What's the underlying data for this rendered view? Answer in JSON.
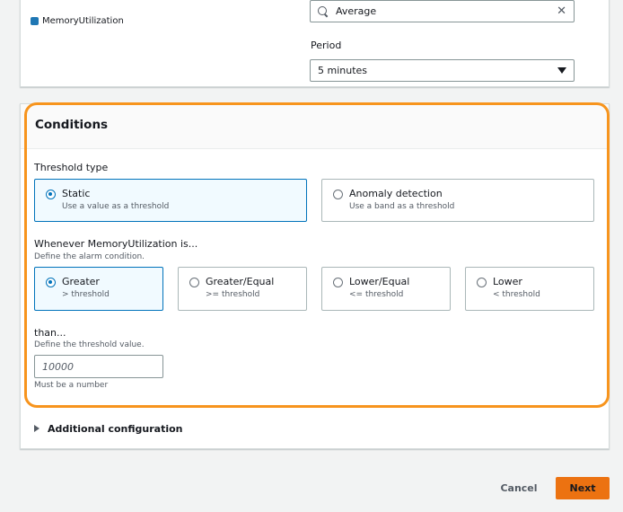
{
  "metric": {
    "legend_label": "MemoryUtilization",
    "legend_color": "#1f77b4",
    "statistic_value": "Average",
    "period_label": "Period",
    "period_value": "5 minutes"
  },
  "conditions": {
    "title": "Conditions",
    "threshold_type": {
      "label": "Threshold type",
      "options": [
        {
          "title": "Static",
          "desc": "Use a value as a threshold",
          "selected": true
        },
        {
          "title": "Anomaly detection",
          "desc": "Use a band as a threshold",
          "selected": false
        }
      ]
    },
    "whenever": {
      "label": "Whenever MemoryUtilization is...",
      "desc": "Define the alarm condition.",
      "options": [
        {
          "title": "Greater",
          "desc": "> threshold",
          "selected": true
        },
        {
          "title": "Greater/Equal",
          "desc": ">= threshold",
          "selected": false
        },
        {
          "title": "Lower/Equal",
          "desc": "<= threshold",
          "selected": false
        },
        {
          "title": "Lower",
          "desc": "< threshold",
          "selected": false
        }
      ]
    },
    "than": {
      "label": "than...",
      "desc": "Define the threshold value.",
      "placeholder": "10000",
      "constraint": "Must be a number"
    }
  },
  "additional": {
    "label": "Additional configuration"
  },
  "footer": {
    "cancel": "Cancel",
    "next": "Next"
  },
  "colors": {
    "accent": "#0073bb",
    "highlight": "#f7941d",
    "primary_button": "#ec7211"
  }
}
